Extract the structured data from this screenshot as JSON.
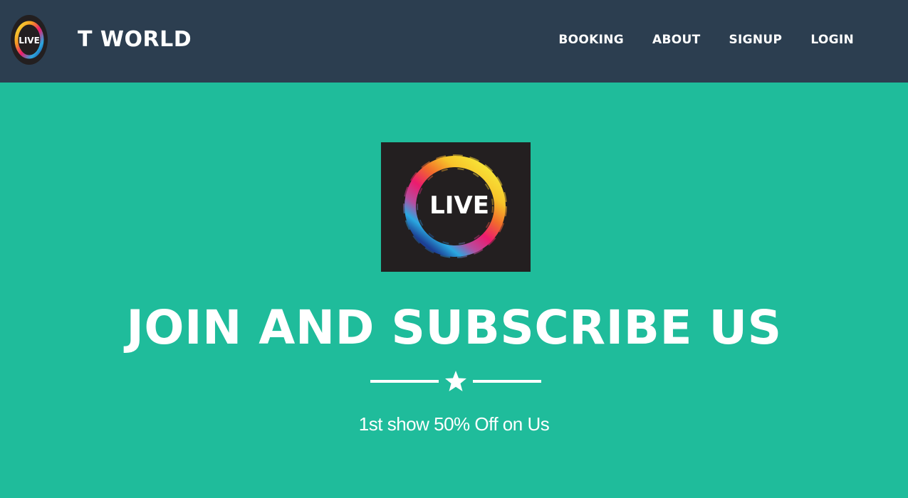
{
  "colors": {
    "navbar_bg": "#2c3e50",
    "hero_bg": "#1fbc9b",
    "text": "#ffffff",
    "logo_bg": "#231f20"
  },
  "header": {
    "logo_icon": "live-logo-icon",
    "logo_text": "LIVE",
    "brand": "T WORLD",
    "nav": [
      {
        "label": "BOOKING"
      },
      {
        "label": "ABOUT"
      },
      {
        "label": "SIGNUP"
      },
      {
        "label": "LOGIN"
      }
    ]
  },
  "hero": {
    "logo_icon": "live-logo-icon",
    "logo_text": "LIVE",
    "title": "JOIN AND SUBSCRIBE US",
    "divider_icon": "star-icon",
    "tagline": "1st show 50% Off on Us"
  }
}
